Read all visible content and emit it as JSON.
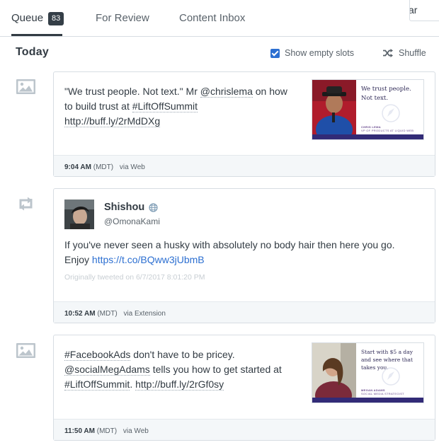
{
  "tabs": {
    "queue": {
      "label": "Queue",
      "count": "83"
    },
    "review": {
      "label": "For Review"
    },
    "inbox": {
      "label": "Content Inbox"
    },
    "corner_button_label": "ar"
  },
  "day": {
    "title": "Today",
    "show_empty_slots": {
      "label": "Show empty slots",
      "checked": true
    },
    "shuffle_label": "Shuffle"
  },
  "posts": [
    {
      "type_icon": "image-icon",
      "text_parts": [
        "\"We trust people. Not text.\" Mr ",
        "@chrislema",
        " on how",
        "to build trust at ",
        "#LiftOffSummit",
        "http://buff.ly/2rMdDXg"
      ],
      "thumbnail": {
        "quote": "We trust people. Not text.",
        "caption_name": "CHRIS LEMA",
        "caption_role": "VP OF PRODUCTS AT LIQUID WEB"
      },
      "time": "9:04 AM",
      "tz": "(MDT)",
      "via": "via Web"
    },
    {
      "type_icon": "retweet-icon",
      "author_name": "Shishou",
      "author_handle": "@OmonaKami",
      "text": "If you've never seen a husky with absolutely no body hair then here you go.",
      "text_prefix": "Enjoy ",
      "text_link": "https://t.co/BQww3jUbmB",
      "meta": "Originally tweeted on 6/7/2017 8:01:20 PM",
      "time": "10:52 AM",
      "tz": "(MDT)",
      "via": "via Extension"
    },
    {
      "type_icon": "image-icon",
      "text_parts": [
        "#FacebookAds",
        " don't have to be pricey.",
        "@socialMegAdams",
        " tells you how to get started at",
        "#LiftOffSummit",
        ". ",
        "http://buff.ly/2rGf0sy"
      ],
      "thumbnail": {
        "quote": "Start with $5 a day and see where that takes you.",
        "caption_name": "MEGAN ADAMS",
        "caption_role": "SOCIAL MEDIA STRATEGIST"
      },
      "time": "11:50 AM",
      "tz": "(MDT)",
      "via": "via Web"
    }
  ],
  "colors": {
    "accent": "#2c6fd1",
    "badge_bg": "#343e47",
    "footer_bg": "#f4f7f9",
    "thumb_bar": "#322b77"
  }
}
